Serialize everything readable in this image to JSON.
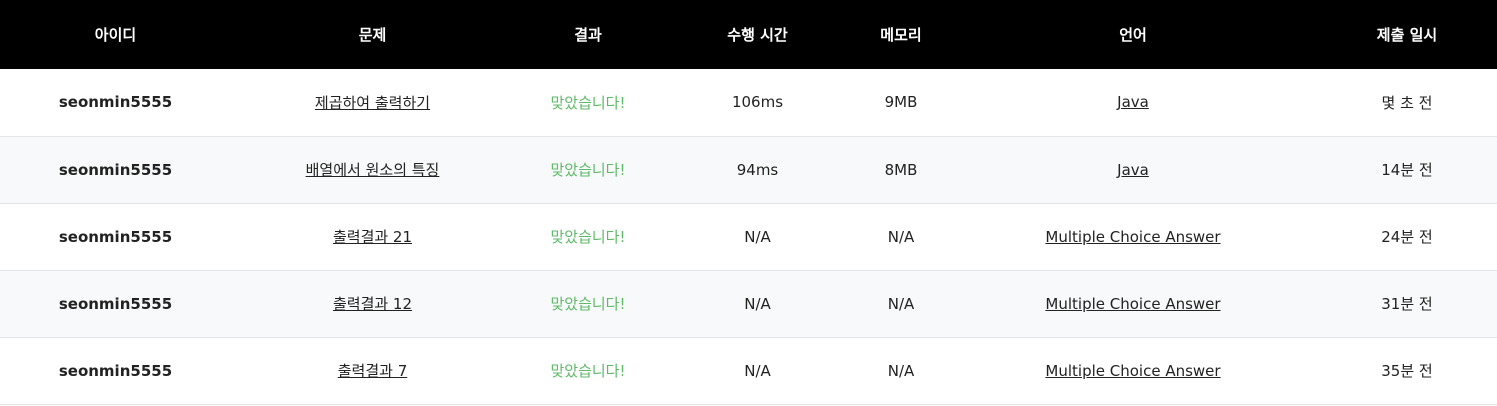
{
  "headers": [
    "아이디",
    "문제",
    "결과",
    "수행 시간",
    "메모리",
    "언어",
    "제출 일시"
  ],
  "rows": [
    {
      "user": "seonmin5555",
      "problem": "제곱하여 출력하기",
      "result": "맞았습니다!",
      "time": "106ms",
      "memory": "9MB",
      "language": "Java",
      "submitted": "몇 초 전"
    },
    {
      "user": "seonmin5555",
      "problem": "배열에서 원소의 특징",
      "result": "맞았습니다!",
      "time": "94ms",
      "memory": "8MB",
      "language": "Java",
      "submitted": "14분 전"
    },
    {
      "user": "seonmin5555",
      "problem": "출력결과 21",
      "result": "맞았습니다!",
      "time": "N/A",
      "memory": "N/A",
      "language": "Multiple Choice Answer",
      "submitted": "24분 전"
    },
    {
      "user": "seonmin5555",
      "problem": "출력결과 12",
      "result": "맞았습니다!",
      "time": "N/A",
      "memory": "N/A",
      "language": "Multiple Choice Answer",
      "submitted": "31분 전"
    },
    {
      "user": "seonmin5555",
      "problem": "출력결과 7",
      "result": "맞았습니다!",
      "time": "N/A",
      "memory": "N/A",
      "language": "Multiple Choice Answer",
      "submitted": "35분 전"
    }
  ],
  "colors": {
    "header_bg": "#000000",
    "accent_correct": "#5fba68",
    "row_alt": "#f7f9fa"
  }
}
